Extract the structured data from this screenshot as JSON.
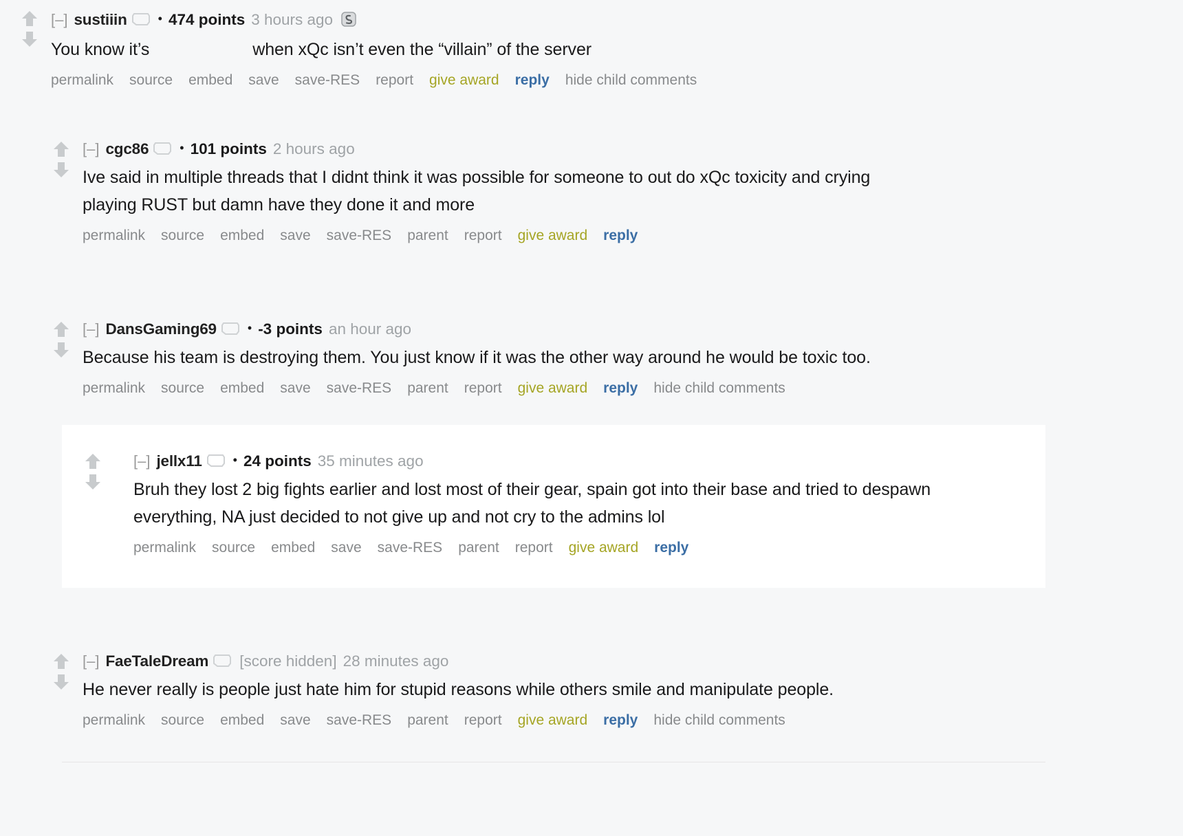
{
  "comments": [
    {
      "id": "sustiiin",
      "collapse": "[–]",
      "username": "sustiiin",
      "bullet": "•",
      "score": "474 points",
      "time": "3 hours ago",
      "award_icon": "silver-award-icon",
      "flair_icon": "comment-bubble-icon",
      "text_before": "You know it’s",
      "text_spoiler": "",
      "text_after": "when xQc isn’t even the “villain” of the server",
      "actions": [
        "permalink",
        "source",
        "embed",
        "save",
        "save-RES",
        "report",
        "give award",
        "reply",
        "hide child comments"
      ]
    },
    {
      "id": "cgc86",
      "collapse": "[–]",
      "username": "cgc86",
      "bullet": "•",
      "score": "101 points",
      "time": "2 hours ago",
      "flair_icon": "comment-bubble-icon",
      "text": "Ive said in multiple threads that I didnt think it was possible for someone to out do xQc toxicity and crying playing RUST but damn have they done it and more",
      "actions": [
        "permalink",
        "source",
        "embed",
        "save",
        "save-RES",
        "parent",
        "report",
        "give award",
        "reply"
      ]
    },
    {
      "id": "dansgaming69",
      "collapse": "[–]",
      "username": "DansGaming69",
      "bullet": "•",
      "score": "-3 points",
      "time": "an hour ago",
      "flair_icon": "comment-bubble-icon",
      "text": "Because his team is destroying them. You just know if it was the other way around he would be toxic too.",
      "actions": [
        "permalink",
        "source",
        "embed",
        "save",
        "save-RES",
        "parent",
        "report",
        "give award",
        "reply",
        "hide child comments"
      ]
    },
    {
      "id": "jellx11",
      "collapse": "[–]",
      "username": "jellx11",
      "bullet": "•",
      "score": "24 points",
      "time": "35 minutes ago",
      "flair_icon": "comment-bubble-icon",
      "text": "Bruh they lost 2 big fights earlier and lost most of their gear, spain got into their base and tried to despawn everything, NA just decided to not give up and not cry to the admins lol",
      "actions": [
        "permalink",
        "source",
        "embed",
        "save",
        "save-RES",
        "parent",
        "report",
        "give award",
        "reply"
      ]
    },
    {
      "id": "faetaledream",
      "collapse": "[–]",
      "username": "FaeTaleDream",
      "score": "[score hidden]",
      "time": "28 minutes ago",
      "flair_icon": "comment-bubble-icon",
      "text": "He never really is people just hate him for stupid reasons while others smile and manipulate people.",
      "actions": [
        "permalink",
        "source",
        "embed",
        "save",
        "save-RES",
        "parent",
        "report",
        "give award",
        "reply",
        "hide child comments"
      ]
    }
  ],
  "colors": {
    "background": "#f6f7f8",
    "highlight_background": "#ffffff",
    "link": "#888a8c",
    "give_award": "#a5a524",
    "reply": "#3b6ea5",
    "muted_text": "#9fa3a6",
    "arrow": "#c8cbcd"
  }
}
